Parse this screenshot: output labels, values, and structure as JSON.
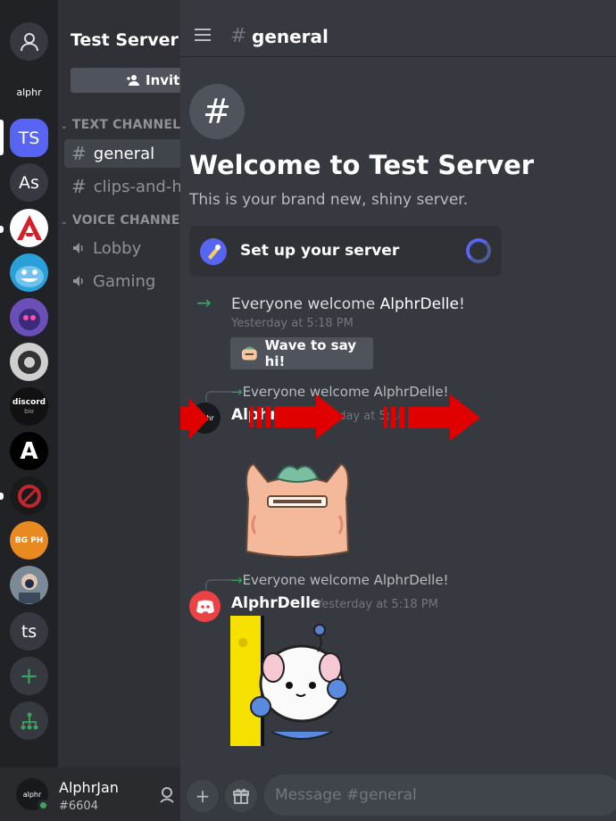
{
  "servers": {
    "home_icon": "dm-home-icon",
    "alphr_logo": "alphr",
    "ts": "TS",
    "as": "As",
    "discord_bio": [
      "discord",
      "bio"
    ],
    "a_logo": "A",
    "bg_ph": "BG PH",
    "ts_lower": "ts",
    "add_icon": "plus-icon",
    "explore_icon": "explore-icon"
  },
  "sidebar": {
    "server_name": "Test Server",
    "invite_label": "Invite",
    "text_category": "TEXT CHANNELS",
    "voice_category": "VOICE CHANNELS",
    "text_channels": [
      "general",
      "clips-and-highlights"
    ],
    "voice_channels": [
      "Lobby",
      "Gaming"
    ]
  },
  "user": {
    "name": "AlphrJan",
    "tag": "#6604",
    "avatar_text": "alphr"
  },
  "header": {
    "channel": "general"
  },
  "welcome": {
    "title": "Welcome to Test Server",
    "subtitle": "This is your brand new, shiny server.",
    "setup_label": "Set up your server"
  },
  "messages": {
    "join1_prefix": "Everyone welcome ",
    "join1_name": "AlphrDelle",
    "join1_suffix": "!",
    "join1_time": "Yesterday at 5:18 PM",
    "wave_label": "Wave to say hi!",
    "reply1": "Everyone welcome AlphrDelle!",
    "author1": "AlphrJan",
    "time1": "Yesterday at 5:18 PM",
    "reply2": "Everyone welcome AlphrDelle!",
    "author2": "AlphrDelle",
    "time2": "Yesterday at 5:18 PM",
    "avatar1_text": "alphr"
  },
  "composer": {
    "placeholder": "Message #general"
  },
  "colors": {
    "accent": "#5865f2",
    "online": "#3ba55d",
    "annotation_arrow": "#e00000"
  }
}
